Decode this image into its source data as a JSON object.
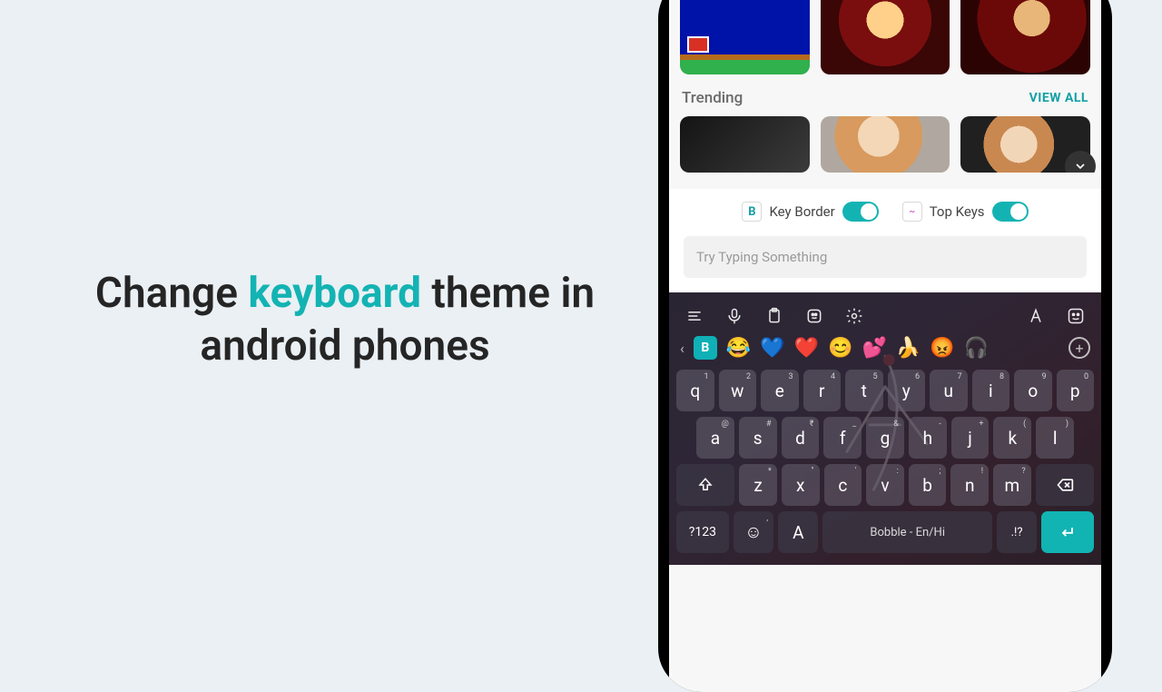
{
  "headline": {
    "before": "Change ",
    "accent": "keyboard",
    "after": " theme in android phones"
  },
  "accent_color": "#14b3b3",
  "themes": {
    "section_label": "Trending",
    "view_all": "VIEW ALL"
  },
  "settings": {
    "key_border": {
      "icon_letter": "B",
      "label": "Key Border",
      "on": true
    },
    "top_keys": {
      "icon_letter": "~",
      "label": "Top Keys",
      "on": true
    },
    "try_placeholder": "Try Typing Something"
  },
  "emoji_row": [
    "😂",
    "💙",
    "❤️",
    "😊",
    "💕",
    "🍌",
    "😡",
    "🎧"
  ],
  "keyboard": {
    "row1": [
      {
        "k": "q",
        "s": "1"
      },
      {
        "k": "w",
        "s": "2"
      },
      {
        "k": "e",
        "s": "3"
      },
      {
        "k": "r",
        "s": "4"
      },
      {
        "k": "t",
        "s": "5"
      },
      {
        "k": "y",
        "s": "6"
      },
      {
        "k": "u",
        "s": "7"
      },
      {
        "k": "i",
        "s": "8"
      },
      {
        "k": "o",
        "s": "9"
      },
      {
        "k": "p",
        "s": "0"
      }
    ],
    "row2": [
      {
        "k": "a",
        "s": "@"
      },
      {
        "k": "s",
        "s": "#"
      },
      {
        "k": "d",
        "s": "₹"
      },
      {
        "k": "f",
        "s": "_"
      },
      {
        "k": "g",
        "s": "&"
      },
      {
        "k": "h",
        "s": "-"
      },
      {
        "k": "j",
        "s": "+"
      },
      {
        "k": "k",
        "s": "("
      },
      {
        "k": "l",
        "s": ")"
      }
    ],
    "row3": [
      {
        "k": "z",
        "s": "*"
      },
      {
        "k": "x",
        "s": "\""
      },
      {
        "k": "c",
        "s": "'"
      },
      {
        "k": "v",
        "s": ":"
      },
      {
        "k": "b",
        "s": ";"
      },
      {
        "k": "n",
        "s": "!"
      },
      {
        "k": "m",
        "s": "?"
      }
    ],
    "bottom": {
      "sym": "?123",
      "comma": ",",
      "lang": "A",
      "space": "Bobble - En/Hi",
      "period": ".!?"
    }
  }
}
